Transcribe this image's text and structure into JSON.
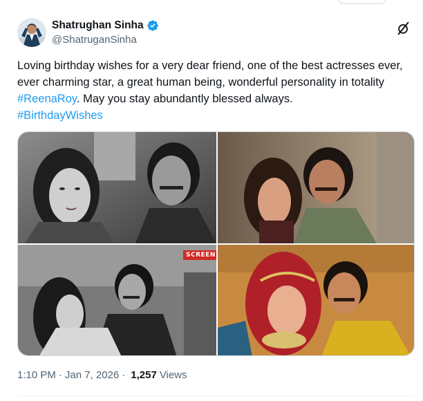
{
  "post": {
    "author": {
      "display_name": "Shatrughan Sinha",
      "handle": "@ShatruganSinha",
      "verified": true
    },
    "text_segments": [
      {
        "type": "text",
        "value": "Loving birthday wishes for a very dear friend, one of the best actresses ever, ever charming star, a great human being, wonderful personality in totality "
      },
      {
        "type": "hashtag",
        "value": "#ReenaRoy"
      },
      {
        "type": "text",
        "value": ". May you stay abundantly blessed always. "
      },
      {
        "type": "hashtag",
        "value": "#BirthdayWishes"
      }
    ],
    "media": {
      "count": 4,
      "images": [
        {
          "id": "photo-1",
          "desc": "black-and-white film still, woman and man"
        },
        {
          "id": "photo-2",
          "desc": "color film still, woman and man"
        },
        {
          "id": "photo-3",
          "desc": "black-and-white film still, couple embracing",
          "badge": "SCREEN"
        },
        {
          "id": "photo-4",
          "desc": "color film still, bride and man"
        }
      ]
    },
    "meta": {
      "time": "1:10 PM",
      "separator": "·",
      "date": "Jan 7, 2026",
      "views_count": "1,257",
      "views_label": "Views"
    }
  },
  "icons": {
    "verified": "verified-badge-icon",
    "more": "grok-slash-icon"
  },
  "colors": {
    "text": "#0f1419",
    "secondary": "#536471",
    "link": "#1d9bf0",
    "border": "#cfd9de"
  }
}
